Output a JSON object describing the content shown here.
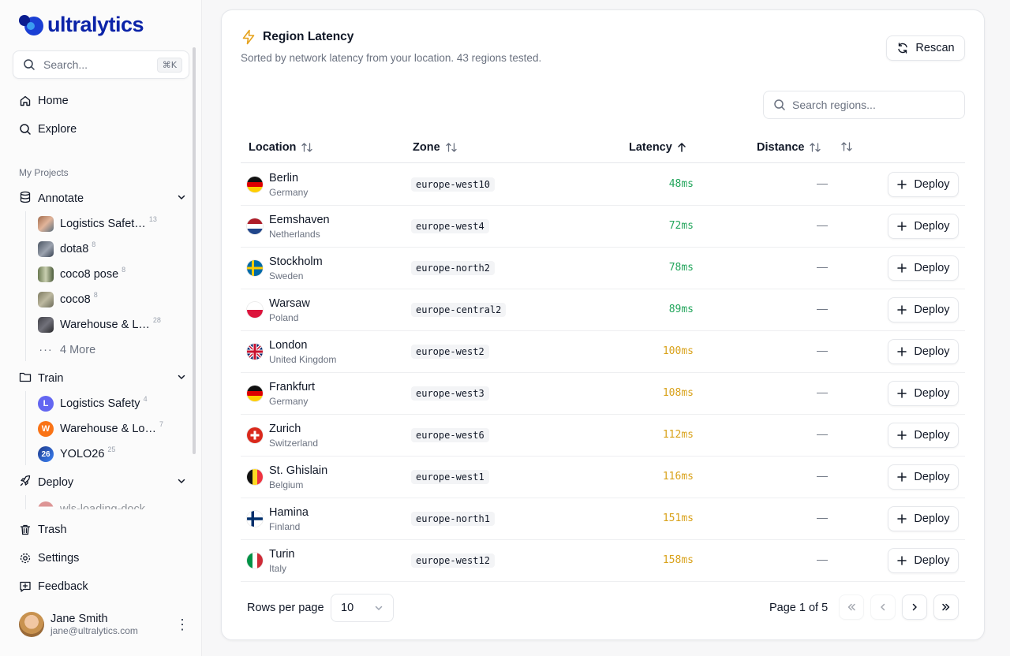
{
  "app": {
    "logo_text": "ultralytics"
  },
  "sidebar": {
    "search_placeholder": "Search...",
    "search_shortcut": "⌘K",
    "home": "Home",
    "explore": "Explore",
    "section_title": "My Projects",
    "annotate": {
      "label": "Annotate",
      "items": [
        {
          "label": "Logistics Safet…",
          "count": "13"
        },
        {
          "label": "dota8",
          "count": "8"
        },
        {
          "label": "coco8 pose",
          "count": "8"
        },
        {
          "label": "coco8",
          "count": "8"
        },
        {
          "label": "Warehouse & L…",
          "count": "28"
        }
      ],
      "more": "4 More"
    },
    "train": {
      "label": "Train",
      "items": [
        {
          "badge": "L",
          "label": "Logistics Safety",
          "count": "4",
          "color": "#6366f1"
        },
        {
          "badge": "W",
          "label": "Warehouse & Lo…",
          "count": "7",
          "color": "#f97316"
        },
        {
          "badge": "26",
          "label": "YOLO26",
          "count": "25",
          "color": "#1e3a8a"
        }
      ]
    },
    "deploy": {
      "label": "Deploy",
      "partial_item": "wls-loading-dock"
    },
    "trash": "Trash",
    "settings": "Settings",
    "feedback": "Feedback",
    "user": {
      "name": "Jane Smith",
      "email": "jane@ultralytics.com"
    }
  },
  "main": {
    "title": "Region Latency",
    "subtitle": "Sorted by network latency from your location. 43 regions tested.",
    "rescan_label": "Rescan",
    "search_placeholder": "Search regions...",
    "columns": {
      "location": "Location",
      "zone": "Zone",
      "latency": "Latency",
      "distance": "Distance"
    },
    "deploy_label": "Deploy",
    "rows": [
      {
        "city": "Berlin",
        "country": "Germany",
        "zone": "europe-west10",
        "latency": "48ms",
        "distance": "—",
        "flag": "de"
      },
      {
        "city": "Eemshaven",
        "country": "Netherlands",
        "zone": "europe-west4",
        "latency": "72ms",
        "distance": "—",
        "flag": "nl"
      },
      {
        "city": "Stockholm",
        "country": "Sweden",
        "zone": "europe-north2",
        "latency": "78ms",
        "distance": "—",
        "flag": "se"
      },
      {
        "city": "Warsaw",
        "country": "Poland",
        "zone": "europe-central2",
        "latency": "89ms",
        "distance": "—",
        "flag": "pl"
      },
      {
        "city": "London",
        "country": "United Kingdom",
        "zone": "europe-west2",
        "latency": "100ms",
        "distance": "—",
        "flag": "gb"
      },
      {
        "city": "Frankfurt",
        "country": "Germany",
        "zone": "europe-west3",
        "latency": "108ms",
        "distance": "—",
        "flag": "de"
      },
      {
        "city": "Zurich",
        "country": "Switzerland",
        "zone": "europe-west6",
        "latency": "112ms",
        "distance": "—",
        "flag": "ch"
      },
      {
        "city": "St. Ghislain",
        "country": "Belgium",
        "zone": "europe-west1",
        "latency": "116ms",
        "distance": "—",
        "flag": "be"
      },
      {
        "city": "Hamina",
        "country": "Finland",
        "zone": "europe-north1",
        "latency": "151ms",
        "distance": "—",
        "flag": "fi"
      },
      {
        "city": "Turin",
        "country": "Italy",
        "zone": "europe-west12",
        "latency": "158ms",
        "distance": "—",
        "flag": "it"
      }
    ],
    "rows_per_page_label": "Rows per page",
    "rows_per_page_value": "10",
    "page_info": "Page 1 of 5"
  },
  "colors": {
    "latency_good": "#22a55b",
    "latency_mid": "#d9a21b",
    "brand": "#0b23a8"
  }
}
